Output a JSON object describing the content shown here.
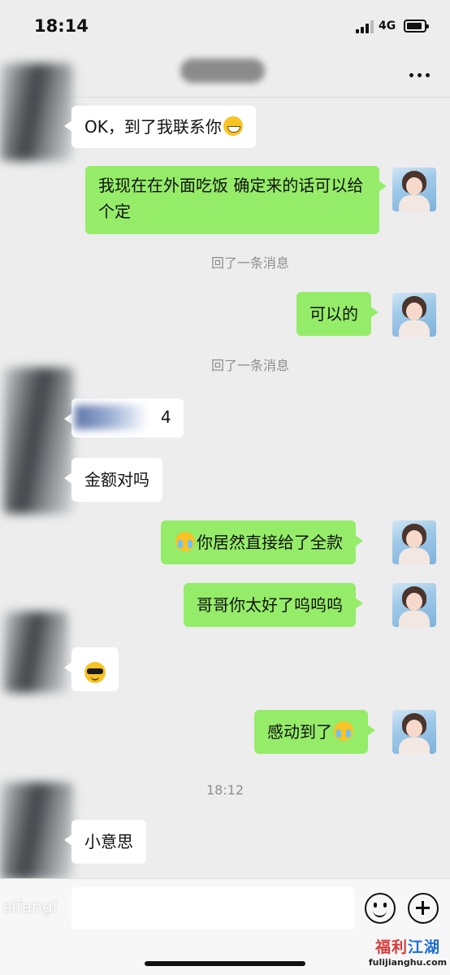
{
  "status_bar": {
    "time": "18:14",
    "network": "4G"
  },
  "messages": [
    {
      "side": "in",
      "text": "OK，到了我联系你",
      "emoji": "grin"
    },
    {
      "side": "out",
      "text": "我现在在外面吃饭 确定来的话可以给个定"
    },
    {
      "type": "system",
      "text": "回了一条消息"
    },
    {
      "side": "out",
      "text": "可以的"
    },
    {
      "type": "system",
      "text": "回了一条消息"
    },
    {
      "side": "in",
      "text": "4"
    },
    {
      "side": "in",
      "text": "金额对吗"
    },
    {
      "side": "out",
      "text": "你居然直接给了全款",
      "emoji": "cry"
    },
    {
      "side": "out",
      "text": "哥哥你太好了呜呜呜"
    },
    {
      "side": "in",
      "emoji": "cool"
    },
    {
      "side": "out",
      "text": "感动到了",
      "emoji": "cry"
    },
    {
      "type": "time",
      "text": "18:12"
    },
    {
      "side": "in",
      "text": "小意思"
    }
  ],
  "input_bar": {
    "ghost_text": "sifangl"
  },
  "watermark": {
    "main_a": "福利",
    "main_b": "江湖",
    "sub": "fulijianghu.com"
  },
  "colors": {
    "outgoing_bubble": "#95ec69",
    "incoming_bubble": "#ffffff",
    "background": "#ededed"
  }
}
